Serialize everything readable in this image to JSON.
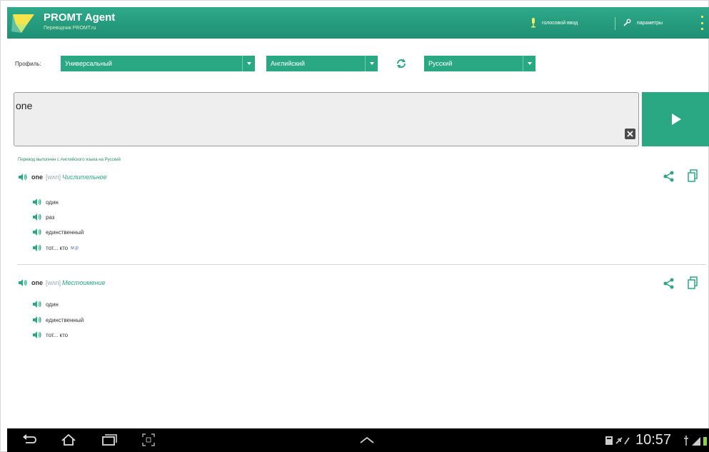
{
  "app": {
    "title": "PROMT Agent",
    "subtitle": "Переводчик PROMT.ru"
  },
  "actionbar": {
    "voice_label": "голосовой ввод",
    "settings_label": "параметры"
  },
  "profile": {
    "label": "Профиль:",
    "value": "Универсальный"
  },
  "languages": {
    "source": "Английский",
    "target": "Русский"
  },
  "input": {
    "text": "one"
  },
  "results": {
    "status": "Перевод выполнен с Английского языка на Русский",
    "entries": [
      {
        "word": "one",
        "transcription": "[wʌn]",
        "pos": "Числительное",
        "items": [
          {
            "text": "один",
            "gram": ""
          },
          {
            "text": "раз",
            "gram": ""
          },
          {
            "text": "единственный",
            "gram": ""
          },
          {
            "text": "тот... кто",
            "gram": "м.р"
          }
        ]
      },
      {
        "word": "one",
        "transcription": "[wʌn]",
        "pos": "Местоимение",
        "items": [
          {
            "text": "один",
            "gram": ""
          },
          {
            "text": "единственный",
            "gram": ""
          },
          {
            "text": "тот... кто",
            "gram": ""
          }
        ]
      }
    ]
  },
  "system": {
    "time": "10:57"
  },
  "colors": {
    "accent": "#2aa884",
    "actionbar": "#1f8f74",
    "system_bar": "#000000"
  },
  "icons": [
    "logo",
    "microphone-icon",
    "wrench-icon",
    "overflow-icon",
    "swap-icon",
    "clear-icon",
    "translate-arrow-icon",
    "speaker-icon",
    "share-icon",
    "copy-icon",
    "back-icon",
    "home-icon",
    "recent-apps-icon",
    "screenshot-icon",
    "up-chevron-icon",
    "signal-icon"
  ]
}
